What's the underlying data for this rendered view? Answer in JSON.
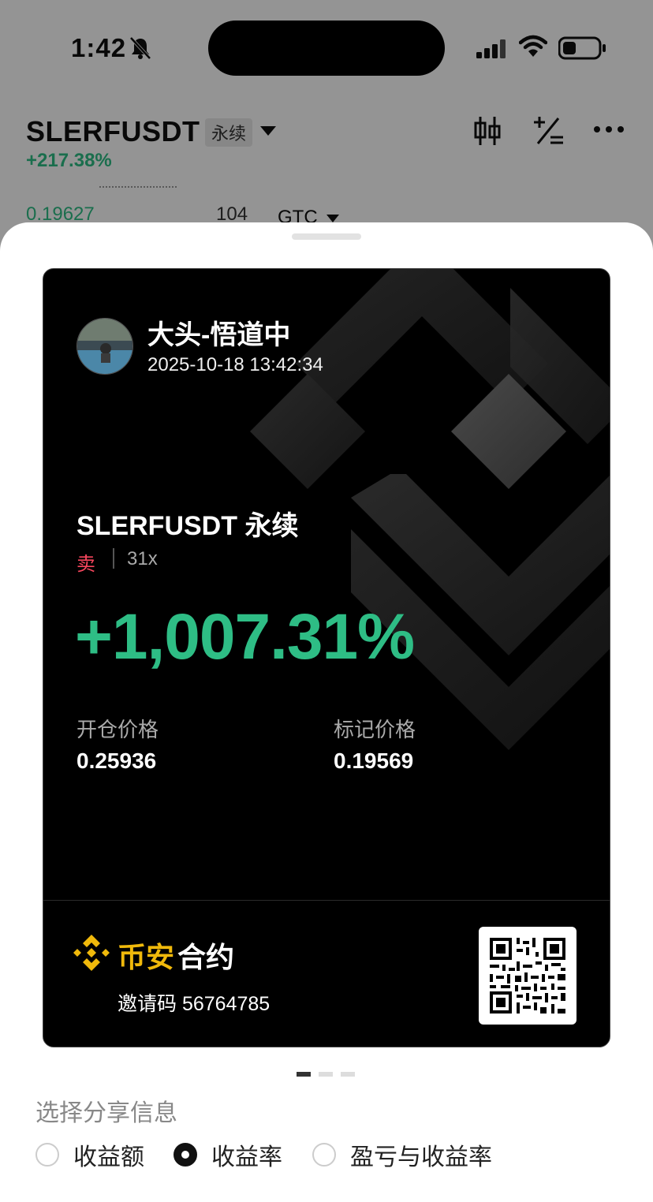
{
  "status_bar": {
    "time": "1:42"
  },
  "background_page": {
    "symbol": "SLERFUSDT",
    "contract_tag": "永续",
    "change": "+217.38%",
    "order_price": "0.19627",
    "order_qty": "104",
    "time_in_force": "GTC"
  },
  "share_card": {
    "user_name": "大头-悟道中",
    "datetime": "2025-10-18 13:42:34",
    "pair": "SLERFUSDT 永续",
    "side": "卖",
    "leverage": "31x",
    "roi": "+1,007.31%",
    "entry_price_label": "开仓价格",
    "entry_price": "0.25936",
    "mark_price_label": "标记价格",
    "mark_price": "0.19569",
    "brand_part1": "币安",
    "brand_part2": "合约",
    "invite_text": "邀请码 56764785"
  },
  "share_options": {
    "title": "选择分享信息",
    "options": [
      {
        "label": "收益额",
        "selected": false
      },
      {
        "label": "收益率",
        "selected": true
      },
      {
        "label": "盈亏与收益率",
        "selected": false
      }
    ]
  },
  "colors": {
    "profit_green": "#2ebd85",
    "sell_red": "#f6465d",
    "binance_yellow": "#f0b90b"
  }
}
